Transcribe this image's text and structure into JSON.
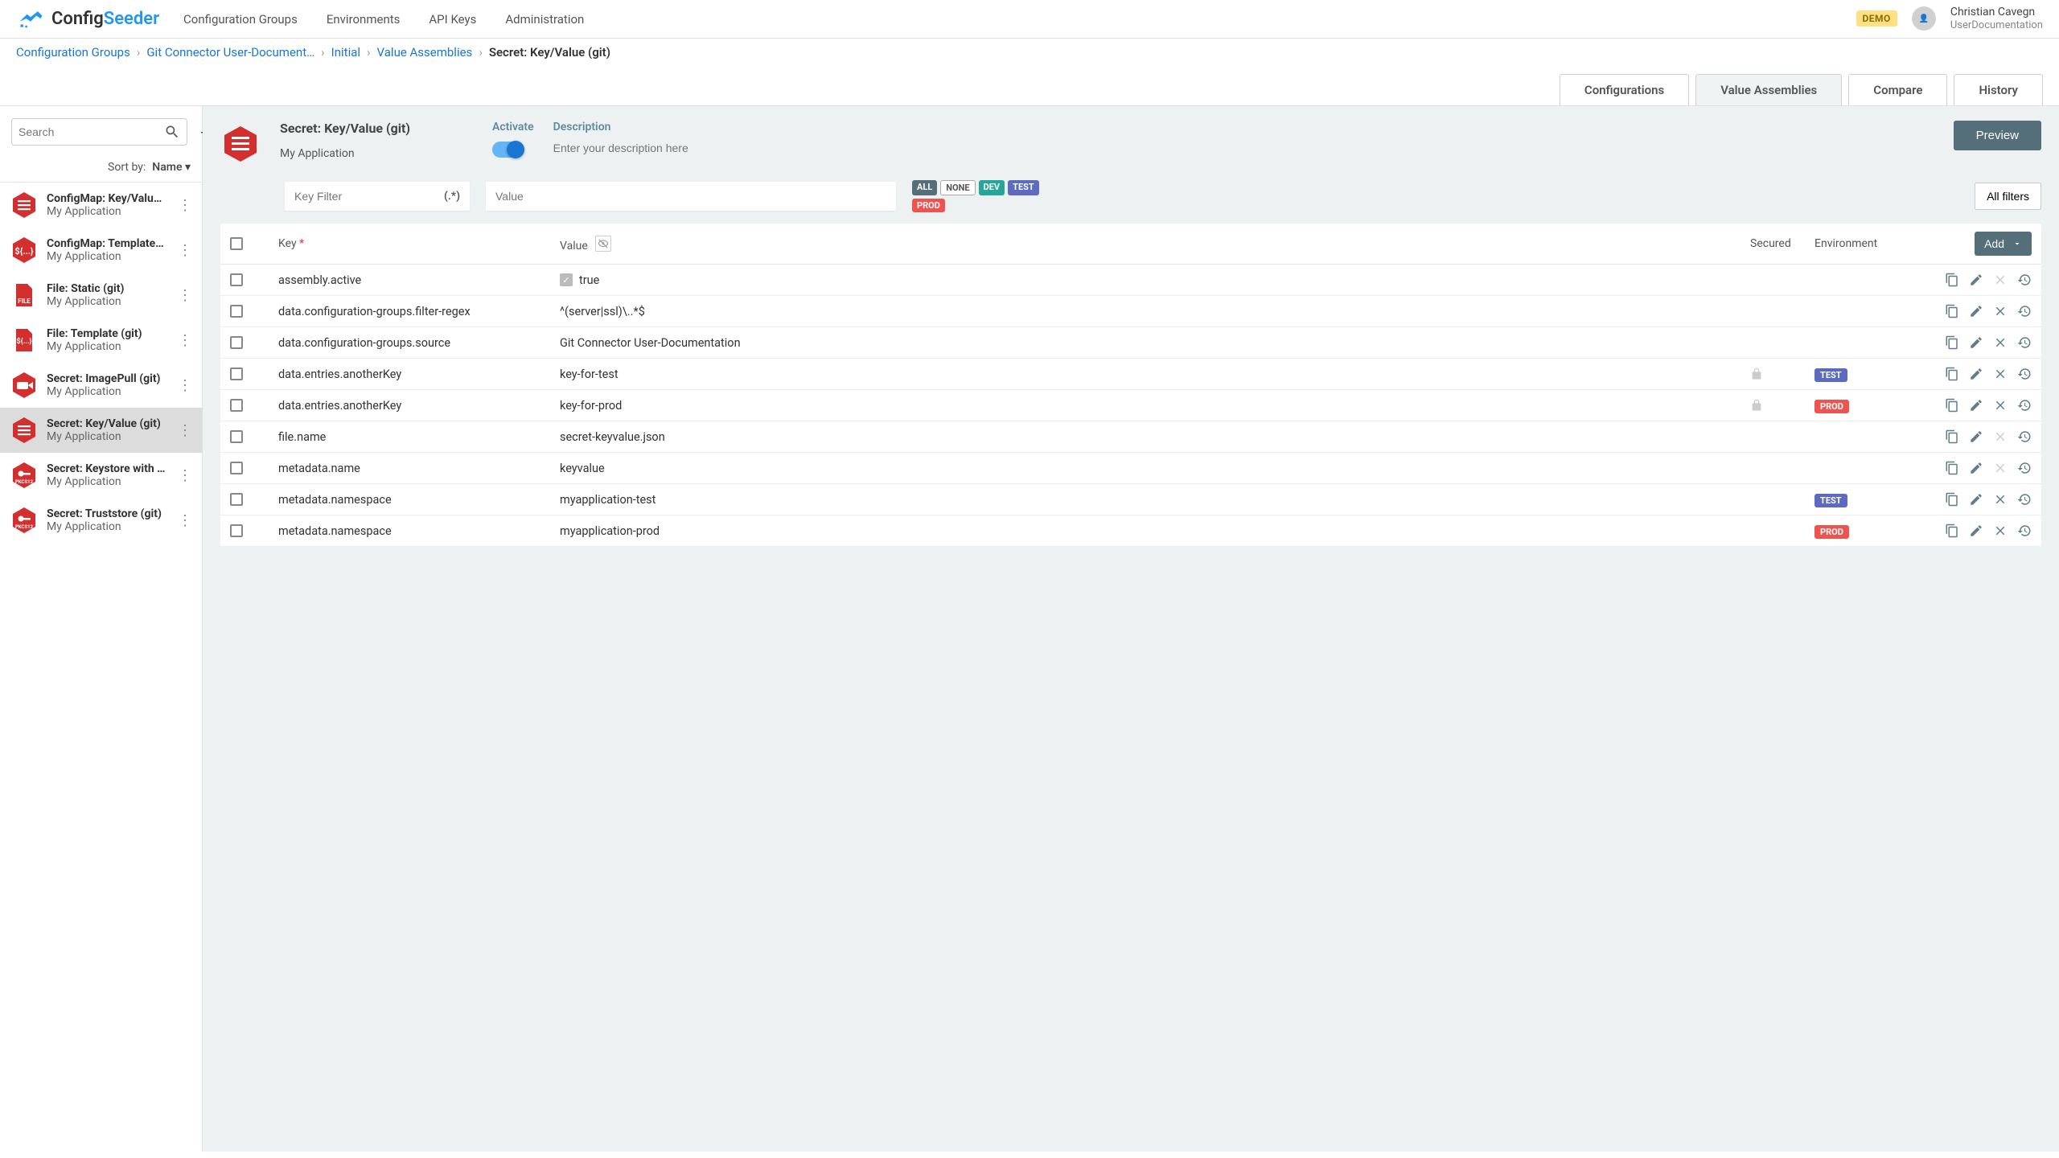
{
  "brand": {
    "config": "Config",
    "seeder": "Seeder"
  },
  "nav": [
    "Configuration Groups",
    "Environments",
    "API Keys",
    "Administration"
  ],
  "demo_badge": "DEMO",
  "user": {
    "name": "Christian Cavegn",
    "org": "UserDocumentation"
  },
  "breadcrumb": {
    "items": [
      "Configuration Groups",
      "Git Connector User-Document…",
      "Initial",
      "Value Assemblies"
    ],
    "current": "Secret: Key/Value (git)"
  },
  "tabs": [
    "Configurations",
    "Value Assemblies",
    "Compare",
    "History"
  ],
  "active_tab": 1,
  "sidebar": {
    "search_placeholder": "Search",
    "sort_label": "Sort by:",
    "sort_value": "Name",
    "items": [
      {
        "title": "ConfigMap: Key/Value …",
        "sub": "My Application",
        "icon": "list",
        "active": false
      },
      {
        "title": "ConfigMap: Template (…",
        "sub": "My Application",
        "icon": "template",
        "active": false
      },
      {
        "title": "File: Static (git)",
        "sub": "My Application",
        "icon": "file",
        "active": false
      },
      {
        "title": "File: Template (git)",
        "sub": "My Application",
        "icon": "file-template",
        "active": false
      },
      {
        "title": "Secret: ImagePull (git)",
        "sub": "My Application",
        "icon": "imagepull",
        "active": false
      },
      {
        "title": "Secret: Key/Value (git)",
        "sub": "My Application",
        "icon": "list",
        "active": true
      },
      {
        "title": "Secret: Keystore with …",
        "sub": "My Application",
        "icon": "pkcs12",
        "active": false
      },
      {
        "title": "Secret: Truststore (git)",
        "sub": "My Application",
        "icon": "pkcs12",
        "active": false
      }
    ]
  },
  "detail": {
    "title": "Secret: Key/Value (git)",
    "sub": "My Application",
    "activate_label": "Activate",
    "activate_on": true,
    "description_label": "Description",
    "description_placeholder": "Enter your description here",
    "preview_btn": "Preview"
  },
  "filters": {
    "key_placeholder": "Key Filter",
    "regex_toggle": "(.*)",
    "value_placeholder": "Value",
    "env_badges": [
      {
        "label": "ALL",
        "class": "b-all"
      },
      {
        "label": "NONE",
        "class": "b-none"
      },
      {
        "label": "DEV",
        "class": "b-dev"
      },
      {
        "label": "TEST",
        "class": "b-test"
      },
      {
        "label": "PROD",
        "class": "b-prod"
      }
    ],
    "all_filters_label": "All filters"
  },
  "table": {
    "headers": {
      "key": "Key",
      "value": "Value",
      "secured": "Secured",
      "environment": "Environment",
      "add": "Add"
    },
    "rows": [
      {
        "key": "assembly.active",
        "value": "true",
        "value_checkbox": true,
        "secured": false,
        "env": null,
        "delete_disabled": true
      },
      {
        "key": "data.configuration-groups.filter-regex",
        "value": "^(server|ssl)\\..*$",
        "secured": false,
        "env": null
      },
      {
        "key": "data.configuration-groups.source",
        "value": "Git Connector User-Documentation",
        "secured": false,
        "env": null
      },
      {
        "key": "data.entries.anotherKey",
        "value": "key-for-test",
        "secured": true,
        "env": "TEST"
      },
      {
        "key": "data.entries.anotherKey",
        "value": "key-for-prod",
        "secured": true,
        "env": "PROD"
      },
      {
        "key": "file.name",
        "value": "secret-keyvalue.json",
        "secured": false,
        "env": null,
        "delete_disabled": true
      },
      {
        "key": "metadata.name",
        "value": "keyvalue",
        "secured": false,
        "env": null,
        "delete_disabled": true
      },
      {
        "key": "metadata.namespace",
        "value": "myapplication-test",
        "secured": false,
        "env": "TEST"
      },
      {
        "key": "metadata.namespace",
        "value": "myapplication-prod",
        "secured": false,
        "env": "PROD"
      }
    ]
  },
  "colors": {
    "accent": "#1976D2",
    "header_btn": "#546e7a",
    "test": "#5C6BC0",
    "prod": "#ef5350",
    "dev": "#26a69a"
  }
}
